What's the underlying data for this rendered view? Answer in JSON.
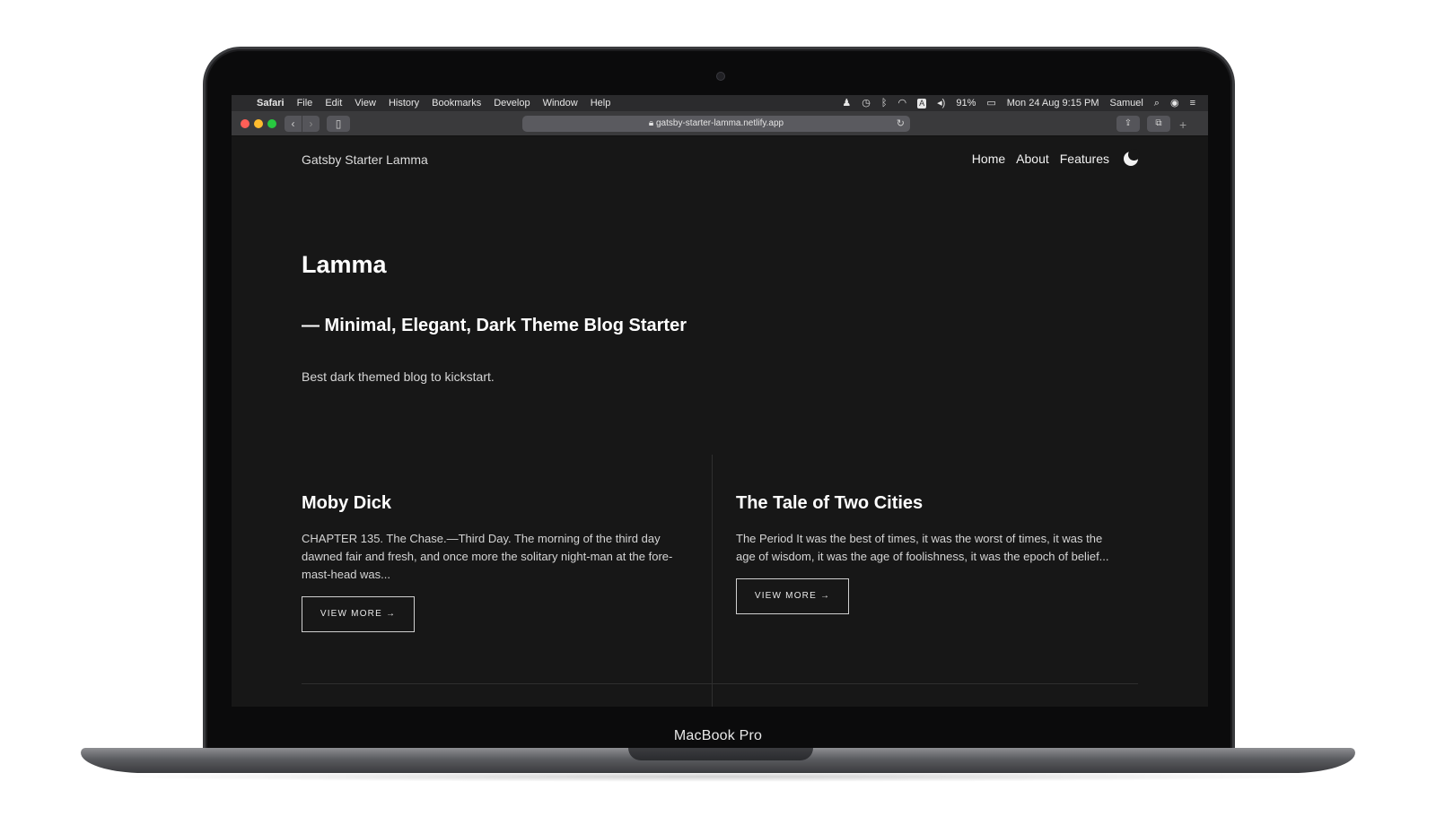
{
  "device": {
    "label": "MacBook Pro"
  },
  "menubar": {
    "apple_icon": "apple-icon",
    "app": "Safari",
    "menus": [
      "File",
      "Edit",
      "View",
      "History",
      "Bookmarks",
      "Develop",
      "Window",
      "Help"
    ],
    "battery": "91%",
    "datetime": "Mon 24 Aug  9:15 PM",
    "user": "Samuel",
    "keyboard_indicator": "A"
  },
  "browser": {
    "url": "gatsby-starter-lamma.netlify.app"
  },
  "site": {
    "title": "Gatsby Starter Lamma",
    "nav": [
      "Home",
      "About",
      "Features"
    ],
    "theme_toggle_icon": "moon-icon"
  },
  "hero": {
    "title": "Lamma",
    "subtitle": "— Minimal, Elegant, Dark Theme Blog Starter",
    "description": "Best dark themed blog to kickstart."
  },
  "posts": [
    {
      "title": "Moby Dick",
      "excerpt": "CHAPTER 135. The Chase.—Third Day. The morning of the third day dawned fair and fresh, and once more the solitary night-man at the fore-mast-head was...",
      "button": "VIEW MORE →"
    },
    {
      "title": "The Tale of Two Cities",
      "excerpt": "The Period It was the best of times, it was the worst of times, it was the age of wisdom, it was the age of foolishness, it was the epoch of belief...",
      "button": "VIEW MORE →"
    }
  ]
}
